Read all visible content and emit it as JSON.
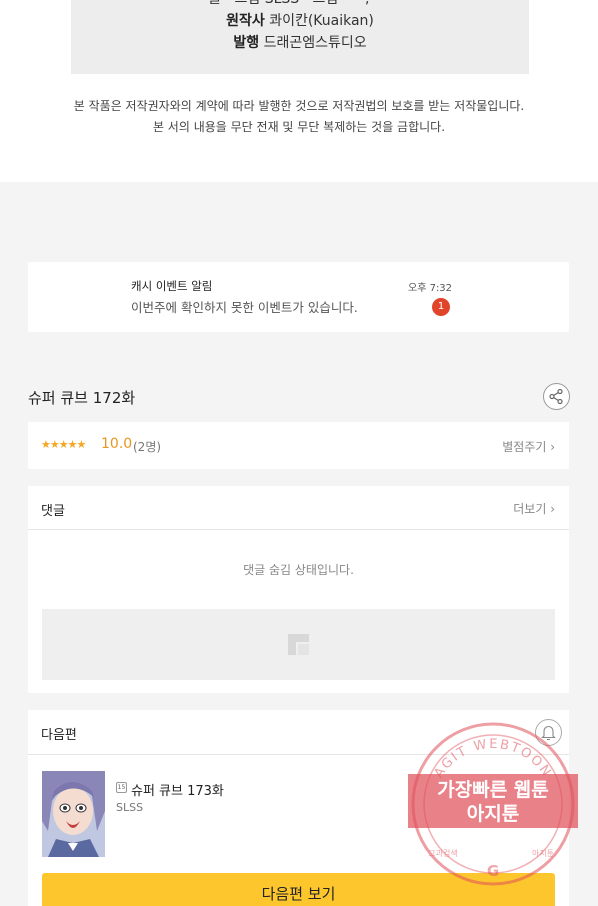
{
  "credits": {
    "cut_line": "글 · 그림 SLSS · 그림 ·· ··, ·· ·",
    "original_label": "원작사",
    "original_value": "콰이칸(Kuaikan)",
    "publisher_label": "발행",
    "publisher_value": "드래곤엠스튜디오"
  },
  "copyright": {
    "line1": "본 작품은 저작권자와의 계약에 따라 발행한 것으로 저작권법의 보호를 받는 저작물입니다.",
    "line2": "본 서의 내용을 무단 전재 및 무단 복제하는 것을 금합니다."
  },
  "notification": {
    "title": "캐시 이벤트 알림",
    "message": "이번주에 확인하지 못한 이벤트가 있습니다.",
    "time": "오후 7:32",
    "badge_count": "1"
  },
  "episode": {
    "title": "슈퍼 큐브 172화",
    "share_icon": "share-icon"
  },
  "rating": {
    "stars": "★★★★★",
    "score": "10.0",
    "count": "(2명)",
    "rate_label": "별점주기 ›"
  },
  "comments": {
    "title": "댓글",
    "more_label": "더보기 ›",
    "hidden_message": "댓글 숨김 상태입니다."
  },
  "next_episode": {
    "section_title": "다음편",
    "age_badge": "15",
    "title": "슈퍼 큐브 173화",
    "author": "SLSS",
    "button_label": "다음편 보기"
  },
  "watermark": {
    "arc_text": "AGIT WEBTOON",
    "main_line1": "가장빠른 웹툰",
    "main_line2": "아지툰",
    "bottom_left": "그과검색",
    "bottom_right": "아지툰",
    "center_letter": "G"
  },
  "colors": {
    "accent_yellow": "#fdc62c",
    "badge_red": "#e0452b",
    "star_orange": "#f5a623",
    "stamp_red": "#e0505a"
  }
}
